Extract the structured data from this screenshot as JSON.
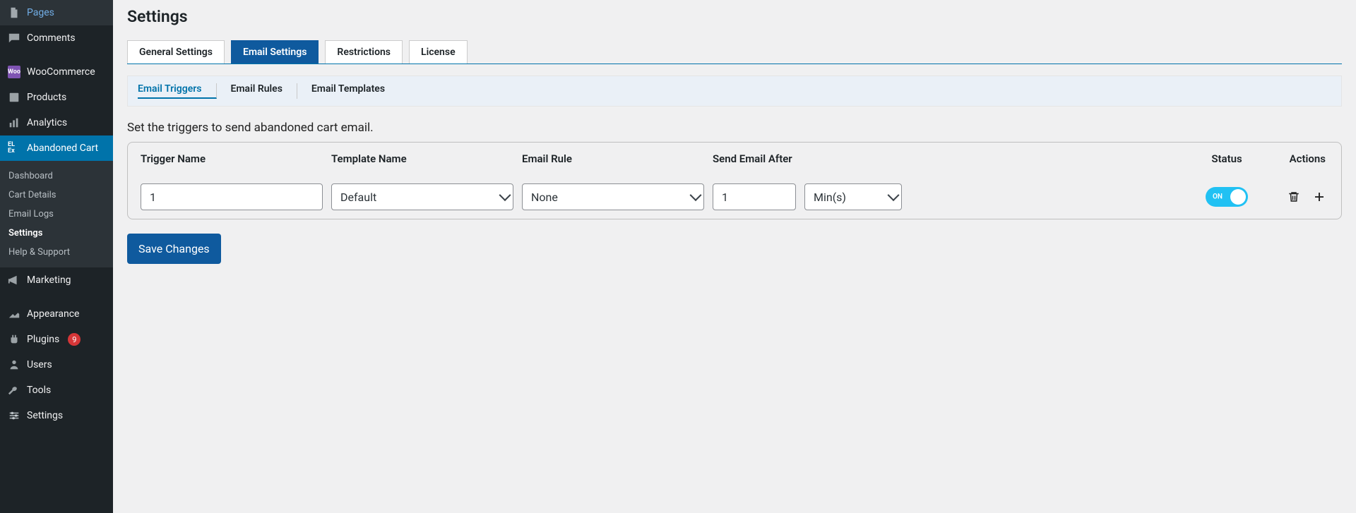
{
  "sidebar": {
    "items": [
      {
        "id": "pages",
        "label": "Pages",
        "icon": "page"
      },
      {
        "id": "comments",
        "label": "Comments",
        "icon": "comment"
      },
      {
        "id": "woocommerce",
        "label": "WooCommerce",
        "icon": "woo"
      },
      {
        "id": "products",
        "label": "Products",
        "icon": "products"
      },
      {
        "id": "analytics",
        "label": "Analytics",
        "icon": "analytics"
      },
      {
        "id": "abandoned-cart",
        "label": "Abandoned Cart",
        "icon": "elex",
        "active": true
      },
      {
        "id": "marketing",
        "label": "Marketing",
        "icon": "marketing"
      },
      {
        "id": "appearance",
        "label": "Appearance",
        "icon": "appearance"
      },
      {
        "id": "plugins",
        "label": "Plugins",
        "icon": "plugins",
        "badge": "9"
      },
      {
        "id": "users",
        "label": "Users",
        "icon": "users"
      },
      {
        "id": "tools",
        "label": "Tools",
        "icon": "tools"
      },
      {
        "id": "settings",
        "label": "Settings",
        "icon": "settings"
      }
    ],
    "submenu": [
      {
        "label": "Dashboard"
      },
      {
        "label": "Cart Details"
      },
      {
        "label": "Email Logs"
      },
      {
        "label": "Settings",
        "current": true
      },
      {
        "label": "Help & Support"
      }
    ]
  },
  "page": {
    "title": "Settings",
    "tabs": [
      {
        "label": "General Settings"
      },
      {
        "label": "Email Settings",
        "active": true
      },
      {
        "label": "Restrictions"
      },
      {
        "label": "License"
      }
    ],
    "subtabs": [
      {
        "label": "Email Triggers",
        "active": true
      },
      {
        "label": "Email Rules"
      },
      {
        "label": "Email Templates"
      }
    ],
    "helpText": "Set the triggers to send abandoned cart email.",
    "columns": {
      "triggerName": "Trigger Name",
      "templateName": "Template Name",
      "emailRule": "Email Rule",
      "sendEmailAfter": "Send Email After",
      "status": "Status",
      "actions": "Actions"
    },
    "row": {
      "triggerName": "1",
      "templateName": "Default",
      "emailRule": "None",
      "sendAfterValue": "1",
      "sendAfterUnit": "Min(s)",
      "status": "ON"
    },
    "saveButton": "Save Changes",
    "elexIcon": "EL Ex",
    "wooIcon": "Woo"
  }
}
